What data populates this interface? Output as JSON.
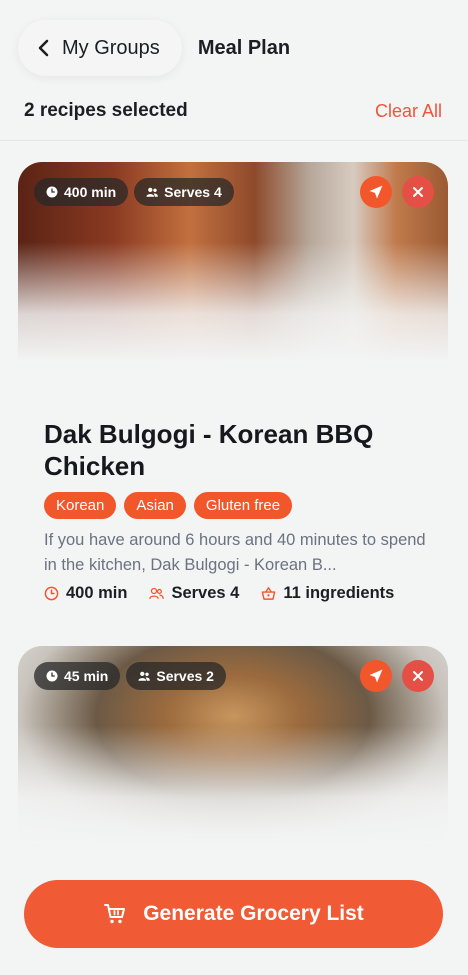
{
  "header": {
    "back_label": "My Groups",
    "title": "Meal Plan"
  },
  "selection": {
    "count_text": "2 recipes selected",
    "clear_label": "Clear All"
  },
  "recipes": [
    {
      "time": "400 min",
      "serves": "Serves 4",
      "title": "Dak Bulgogi - Korean BBQ Chicken",
      "tags": [
        "Korean",
        "Asian",
        "Gluten free"
      ],
      "description": "If you have around 6 hours and 40 minutes to spend in the kitchen, Dak Bulgogi - Korean B...",
      "meta_time": "400 min",
      "meta_serves": "Serves 4",
      "meta_ingredients": "11 ingredients"
    },
    {
      "time": "45 min",
      "serves": "Serves 2"
    }
  ],
  "cta": {
    "label": "Generate Grocery List"
  },
  "colors": {
    "accent": "#f2572b",
    "remove": "#e45046",
    "background": "#f3f4f4"
  }
}
